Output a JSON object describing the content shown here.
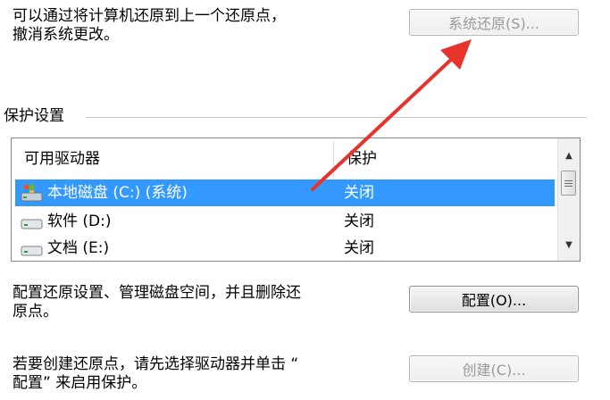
{
  "restore_section": {
    "line1": "可以通过将计算机还原到上一个还原点，",
    "line2": "撤消系统更改。",
    "button_label": "系统还原(S)..."
  },
  "protection_settings": {
    "group_title": "保护设置",
    "columns": [
      "可用驱动器",
      "保护"
    ],
    "drives": [
      {
        "name": "本地磁盘 (C:) (系统)",
        "protection": "关闭",
        "selected": true,
        "icon": "system-drive-icon"
      },
      {
        "name": "软件 (D:)",
        "protection": "关闭",
        "selected": false,
        "icon": "hard-drive-icon"
      },
      {
        "name": "文档 (E:)",
        "protection": "关闭",
        "selected": false,
        "icon": "hard-drive-icon"
      }
    ]
  },
  "configure_section": {
    "line1": "配置还原设置、管理磁盘空间，并且删除还",
    "line2": "原点。",
    "button_label": "配置(O)..."
  },
  "create_section": {
    "line1": "若要创建还原点，请先选择驱动器并单击 “",
    "line2": "配置” 来启用保护。",
    "button_label": "创建(C)..."
  },
  "colors": {
    "selection": "#3399ff",
    "annotation_arrow": "#e8332d",
    "disabled_text": "#9a9a9a"
  }
}
